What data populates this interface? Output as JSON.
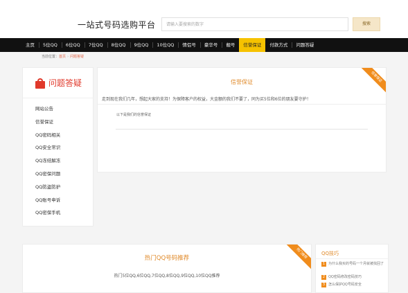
{
  "header": {
    "site_title": "一站式号码选购平台",
    "search_placeholder": "请输入要搜索的数字",
    "search_button": "搜索"
  },
  "nav": {
    "items": [
      "主页",
      "5位QQ",
      "6位QQ",
      "7位QQ",
      "8位QQ",
      "9位QQ",
      "10位QQ",
      "情侣号",
      "豪华号",
      "靓号",
      "信誉保证",
      "付款方式",
      "问题答疑"
    ],
    "active_index": 10
  },
  "breadcrumb": {
    "current_position": "当前位置：",
    "home": "首页",
    "separator": "›",
    "current": "问题答疑"
  },
  "sidebar": {
    "title": "问题答疑",
    "icon": "shopping-bag-icon",
    "items": [
      "网站公告",
      "信誉保证",
      "QQ密码相关",
      "QQ安全常识",
      "QQ冻结解冻",
      "QQ密保问题",
      "QQ防盗防护",
      "QQ账号申诉",
      "QQ密保手机"
    ]
  },
  "panel": {
    "title": "信誉保证",
    "description": "走到现在我们几年，想起大家的支持！为保障客户的权益，大金额的我们不要了，同为买5位和6位的朋友要守护！",
    "sub_text": "以下是我们的信誉保证",
    "ribbon": "信誉保证"
  },
  "hot": {
    "title": "热门QQ号码推荐",
    "description": "热门5位QQ,6位QQ,7位QQ,8位QQ,9位QQ,10位QQ推荐",
    "ribbon": "热门推荐"
  },
  "skills": {
    "title": "QQ技巧",
    "items": [
      {
        "num": "1",
        "text": "为什么我买的号码一个月就被找回了"
      },
      {
        "num": "2",
        "text": "QQ密码修改密码技巧"
      },
      {
        "num": "3",
        "text": "怎么保护QQ号码安全"
      }
    ]
  },
  "colors": {
    "nav_bg": "#111111",
    "nav_active": "#f6c200",
    "accent_orange": "#f08c1c",
    "title_orange": "#e08a2a",
    "brand_red": "#e0392b"
  }
}
